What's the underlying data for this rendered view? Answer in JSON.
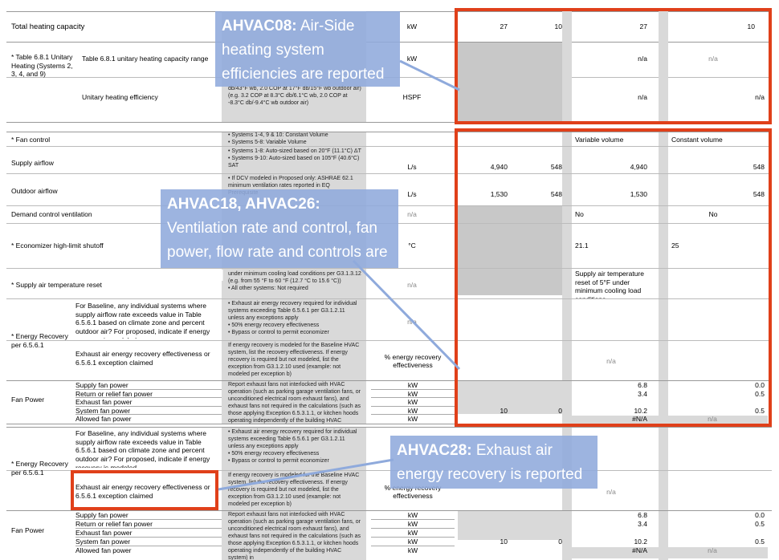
{
  "section1": {
    "total_heating_label": "Total heating capacity",
    "total_heating_unit": "kW",
    "total_heating_vals": [
      "27",
      "10",
      "27",
      "10"
    ],
    "table_group": "* Table 6.8.1 Unitary Heating (Systems 2, 3, 4, and 9)",
    "range_label": "Table 6.8.1 unitary heating capacity range",
    "range_unit": "kW",
    "range_vals": [
      "n/a",
      "n/a"
    ],
    "eff_label": "Unitary heating efficiency",
    "eff_note": "db/43°F wb, 2.0 COP at 17°F db/15°F wb outdoor air) (e.g. 3.2 COP at 8.3°C db/6.1°C wb, 2.0 COP at -8.3°C db/-9.4°C wb outdoor air)",
    "eff_unit": "HSPF",
    "eff_vals": [
      "n/a",
      "n/a"
    ]
  },
  "section2": {
    "fan_control_label": "* Fan control",
    "fan_control_note": "• Systems 1-4, 9 & 10: Constant Volume\n• Systems 5-8: Variable Volume",
    "fan_control_vals": [
      "Variable volume",
      "Constant volume"
    ],
    "supply_label": "Supply airflow",
    "supply_note": "• Systems 1-8: Auto-sized based on 20°F (11.1°C) ΔT\n• Systems 9-10: Auto-sized based on 105°F (40.6°C) SAT",
    "supply_unit": "L/s",
    "supply_vals": [
      "4,940",
      "548",
      "4,940",
      "548"
    ],
    "outdoor_label": "Outdoor airflow",
    "outdoor_note": "• If DCV modeled in Proposed only: ASHRAE 62.1 minimum ventilation rates reported in EQ Prerequisite",
    "outdoor_unit": "L/s",
    "outdoor_vals": [
      "1,530",
      "548",
      "1,530",
      "548"
    ],
    "dcv_label": "Demand control ventilation",
    "dcv_unit": "n/a",
    "dcv_vals": [
      "No",
      "No"
    ],
    "econ_label": "* Economizer high-limit shutoff",
    "econ_unit": "°C",
    "econ_vals": [
      "21.1",
      "25"
    ],
    "sat_label": "* Supply air temperature reset",
    "sat_note": "under minimum cooling load conditions per G3.1.3.12 (e.g. from 55 °F to 60 °F (12.7 °C to 15.6 °C))\n• All other systems: Not required",
    "sat_unit": "n/a",
    "sat_val": "Supply air temperature reset of 5°F under minimum cooling load conditions",
    "er_group": "* Energy Recovery per 6.5.6.1",
    "er_q": "For Baseline, any individual systems where supply airflow rate exceeds value in Table 6.5.6.1 based on climate zone and percent outdoor air? For proposed, indicate if energy recovery is modeled.",
    "er_q_note": "• Exhaust air energy recovery required for individual systems exceeding Table 6.5.6.1 per G3.1.2.11 unless any exceptions apply\n• 50% energy recovery effectiveness\n• Bypass or control to permit economizer",
    "er_q_unit": "n/a",
    "er_eff": "Exhaust air energy recovery effectiveness or 6.5.6.1 exception claimed",
    "er_eff_note": "If energy recovery is modeled for the Baseline HVAC system, list the recovery effectiveness. If energy recovery is required but not modeled, list the exception from G3.1.2.10 used (example: not modeled per exception b)",
    "er_eff_unit": "% energy recovery effectiveness",
    "er_eff_val": "n/a",
    "fan_group": "Fan Power",
    "fan_rows": [
      {
        "label": "Supply fan power",
        "unit": "kW",
        "v1": "",
        "v2": "",
        "v3": "6.8",
        "v4": "0.0"
      },
      {
        "label": "Return or relief fan power",
        "unit": "kW",
        "v1": "",
        "v2": "",
        "v3": "3.4",
        "v4": "0.5"
      },
      {
        "label": "Exhaust fan power",
        "unit": "kW",
        "v1": "",
        "v2": "",
        "v3": "",
        "v4": ""
      },
      {
        "label": "System fan power",
        "unit": "kW",
        "v1": "10",
        "v2": "0",
        "v3": "10.2",
        "v4": "0.5"
      },
      {
        "label": "Allowed fan power",
        "unit": "kW",
        "v1": "",
        "v2": "",
        "v3": "#N/A",
        "v4": "n/a"
      }
    ],
    "fan_note": "Report exhaust fans not interlocked with HVAC operation (such as parking garage ventilation fans, or unconditioned electrical room exhaust fans), and exhaust fans not required in the calculations (such as those applying Exception 6.5.3.1.1, or kitchen hoods operating independently of the building HVAC system) in"
  },
  "section3": {
    "er_group": "* Energy Recovery per 6.5.6.1",
    "er_q": "For Baseline, any individual systems where supply airflow rate exceeds value in Table 6.5.6.1 based on climate zone and percent outdoor air? For proposed, indicate if energy recovery is modeled",
    "er_q_note": "• Exhaust air energy recovery required for individual systems exceeding Table 6.5.6.1 per G3.1.2.11 unless any exceptions apply\n• 50% energy recovery effectiveness\n• Bypass or control to permit economizer",
    "er_eff": "Exhaust air energy recovery effectiveness or 6.5.6.1 exception claimed",
    "er_eff_note": "If energy recovery is modeled for the Baseline HVAC system, list the recovery effectiveness. If energy recovery is required but not modeled, list the exception from G3.1.2.10 used (example: not modeled per exception b)",
    "er_eff_unit": "% energy recovery effectiveness",
    "er_eff_val": "n/a",
    "fan_group": "Fan Power",
    "fan_rows": [
      {
        "label": "Supply fan power",
        "unit": "kW",
        "v1": "",
        "v2": "",
        "v3": "6.8",
        "v4": "0.0"
      },
      {
        "label": "Return or relief fan power",
        "unit": "kW",
        "v1": "",
        "v2": "",
        "v3": "3.4",
        "v4": "0.5"
      },
      {
        "label": "Exhaust fan power",
        "unit": "kW",
        "v1": "",
        "v2": "",
        "v3": "",
        "v4": ""
      },
      {
        "label": "System fan power",
        "unit": "kW",
        "v1": "10",
        "v2": "0",
        "v3": "10.2",
        "v4": "0.5"
      },
      {
        "label": "Allowed fan power",
        "unit": "kW",
        "v1": "",
        "v2": "",
        "v3": "#N/A",
        "v4": "n/a"
      }
    ],
    "fan_note": "Report exhaust fans not interlocked with HVAC operation (such as parking garage ventilation fans, or unconditioned electrical room exhaust fans), and exhaust fans not required in the calculations (such as those applying Exception 6.5.3.1.1, or kitchen hoods operating independently of the building HVAC system) in"
  },
  "callouts": {
    "c1_code": "AHVAC08:",
    "c1_text": " Air-Side heating system efficiencies are reported",
    "c2_code": "AHVAC18, AHVAC26:",
    "c2_text": " Ventilation rate and control, fan power, flow rate and controls are reported",
    "c3_code": "AHVAC28:",
    "c3_text": " Exhaust air energy recovery is reported"
  },
  "colors": {
    "highlight_box": "#e0401a",
    "callout_bg": "#8faadc",
    "note_gray": "#d9d9d9"
  }
}
